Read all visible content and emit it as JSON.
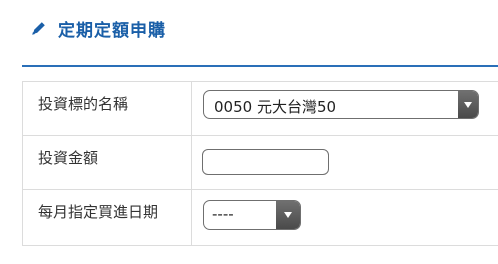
{
  "header": {
    "title": "定期定額申購",
    "icon": "pencil-icon"
  },
  "form": {
    "fund": {
      "label": "投資標的名稱",
      "selected": "0050 元大台灣50"
    },
    "amount": {
      "label": "投資金額",
      "value": ""
    },
    "date": {
      "label": "每月指定買進日期",
      "selected": "----"
    }
  },
  "colors": {
    "accent": "#1a5fa8",
    "rule": "#2a6fb8",
    "border": "#dcdcdc"
  }
}
